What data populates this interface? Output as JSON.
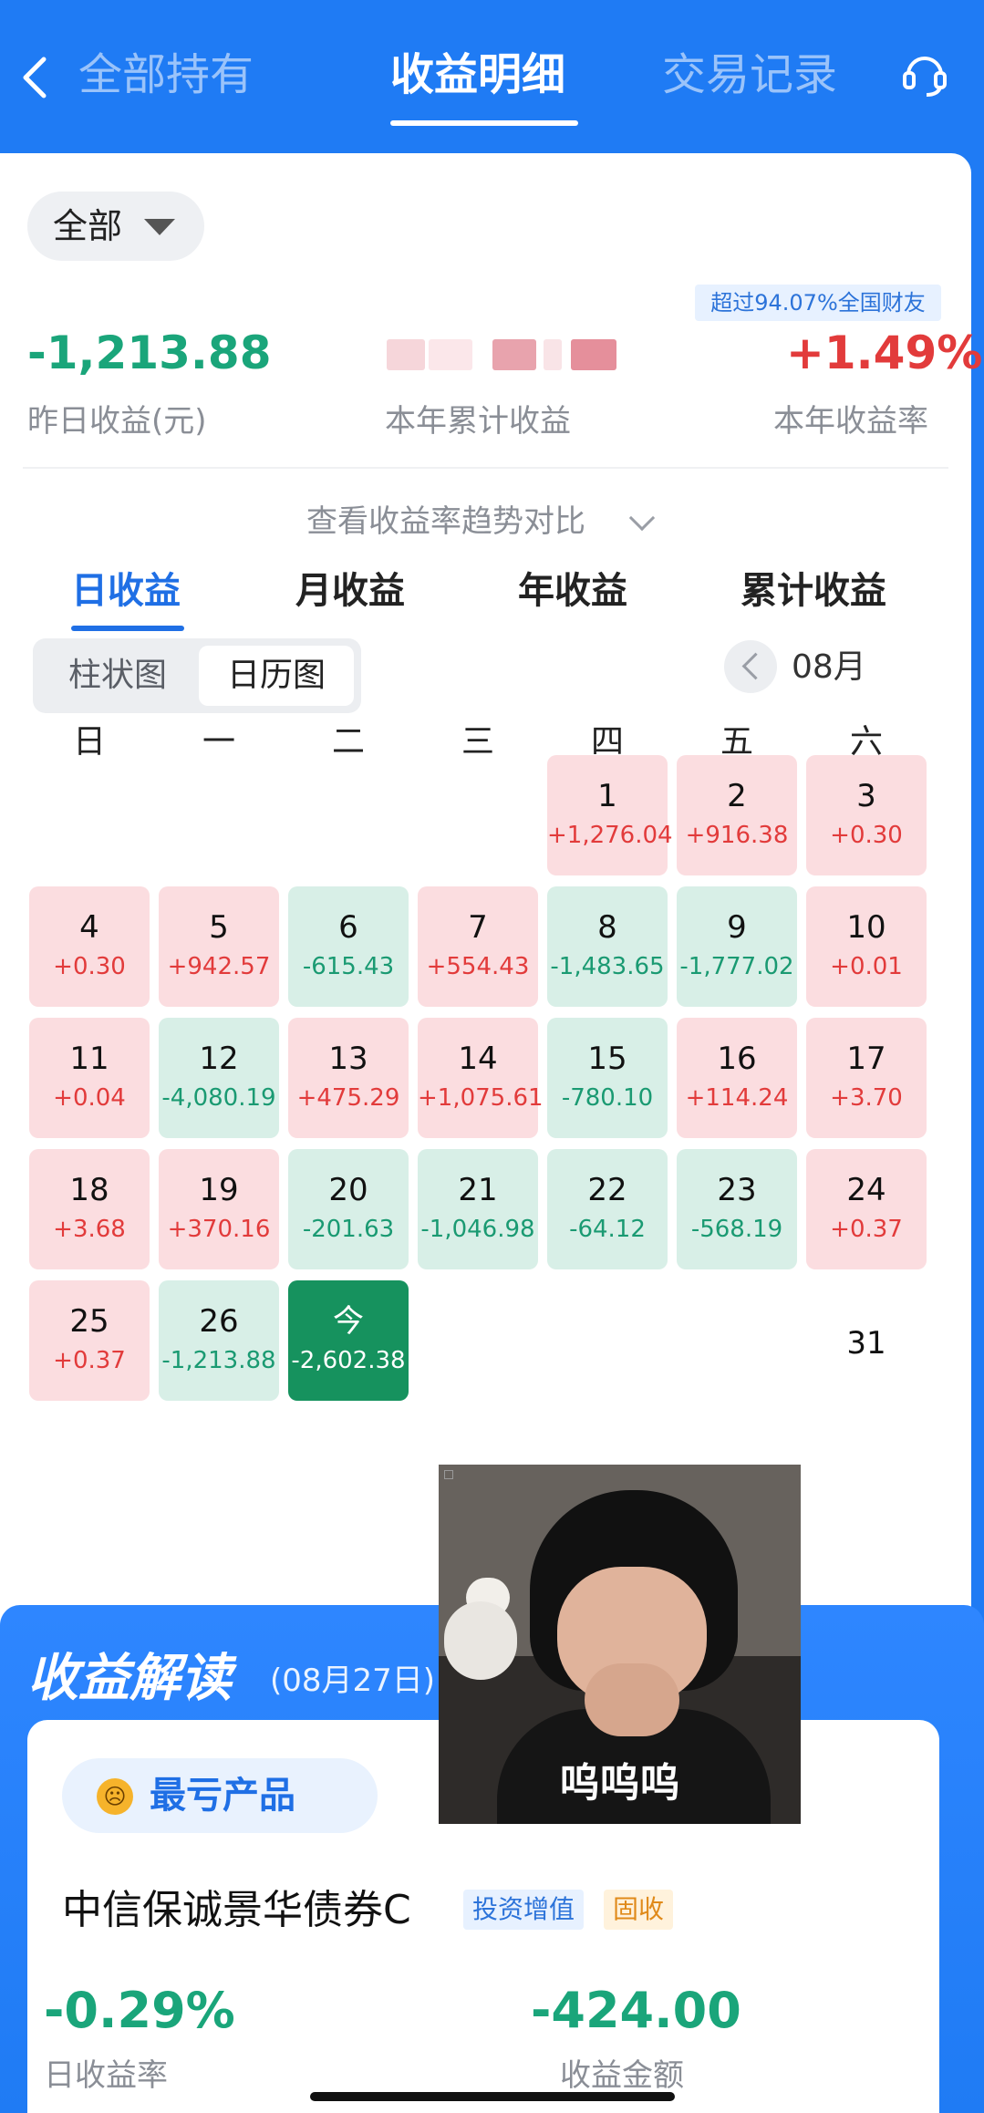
{
  "header": {
    "tabs": [
      {
        "label": "全部持有",
        "active": false
      },
      {
        "label": "收益明细",
        "active": true
      },
      {
        "label": "交易记录",
        "active": false
      }
    ],
    "back_icon": "chevron-left-icon",
    "service_icon": "headset-icon"
  },
  "summary": {
    "filter_label": "全部",
    "rank_badge": "超过94.07%全国财友",
    "yesterday_value": "-1,213.88",
    "yesterday_label": "昨日收益(元)",
    "ytd_label": "本年累计收益",
    "ytd_rate_value": "+1.49%",
    "ytd_rate_label": "本年收益率",
    "trend_link": "查看收益率趋势对比"
  },
  "period_tabs": [
    "日收益",
    "月收益",
    "年收益",
    "累计收益"
  ],
  "view_toggle": [
    "柱状图",
    "日历图"
  ],
  "month": "08月",
  "weekdays": [
    "日",
    "一",
    "二",
    "三",
    "四",
    "五",
    "六"
  ],
  "calendar": [
    {
      "day": "1",
      "value": "+1,276.04",
      "kind": "pos"
    },
    {
      "day": "2",
      "value": "+916.38",
      "kind": "pos"
    },
    {
      "day": "3",
      "value": "+0.30",
      "kind": "pos"
    },
    {
      "day": "4",
      "value": "+0.30",
      "kind": "pos"
    },
    {
      "day": "5",
      "value": "+942.57",
      "kind": "pos"
    },
    {
      "day": "6",
      "value": "-615.43",
      "kind": "neg"
    },
    {
      "day": "7",
      "value": "+554.43",
      "kind": "pos"
    },
    {
      "day": "8",
      "value": "-1,483.65",
      "kind": "neg"
    },
    {
      "day": "9",
      "value": "-1,777.02",
      "kind": "neg"
    },
    {
      "day": "10",
      "value": "+0.01",
      "kind": "pos"
    },
    {
      "day": "11",
      "value": "+0.04",
      "kind": "pos"
    },
    {
      "day": "12",
      "value": "-4,080.19",
      "kind": "neg"
    },
    {
      "day": "13",
      "value": "+475.29",
      "kind": "pos"
    },
    {
      "day": "14",
      "value": "+1,075.61",
      "kind": "pos"
    },
    {
      "day": "15",
      "value": "-780.10",
      "kind": "neg"
    },
    {
      "day": "16",
      "value": "+114.24",
      "kind": "pos"
    },
    {
      "day": "17",
      "value": "+3.70",
      "kind": "pos"
    },
    {
      "day": "18",
      "value": "+3.68",
      "kind": "pos"
    },
    {
      "day": "19",
      "value": "+370.16",
      "kind": "pos"
    },
    {
      "day": "20",
      "value": "-201.63",
      "kind": "neg"
    },
    {
      "day": "21",
      "value": "-1,046.98",
      "kind": "neg"
    },
    {
      "day": "22",
      "value": "-64.12",
      "kind": "neg"
    },
    {
      "day": "23",
      "value": "-568.19",
      "kind": "neg"
    },
    {
      "day": "24",
      "value": "+0.37",
      "kind": "pos"
    },
    {
      "day": "25",
      "value": "+0.37",
      "kind": "pos"
    },
    {
      "day": "26",
      "value": "-1,213.88",
      "kind": "neg"
    },
    {
      "day": "今",
      "value": "-2,602.38",
      "kind": "today"
    },
    {
      "day": "31",
      "value": "",
      "kind": "empty"
    }
  ],
  "interpretation": {
    "title": "收益解读",
    "date": "(08月27日)",
    "pill_label": "最亏产品",
    "fund_name": "中信保诚景华债券C",
    "tags": [
      "投资增值",
      "固收"
    ],
    "daily_rate_value": "-0.29%",
    "daily_rate_label": "日收益率",
    "amount_value": "-424.00",
    "amount_label": "收益金额"
  },
  "meme": {
    "caption": "呜呜呜"
  },
  "colors": {
    "brand_blue": "#1f7bf4",
    "gain_red": "#e23b3b",
    "loss_green": "#1aa57a",
    "gain_cell": "#fbdde0",
    "loss_cell": "#d8efe7",
    "today_cell": "#16925e"
  }
}
